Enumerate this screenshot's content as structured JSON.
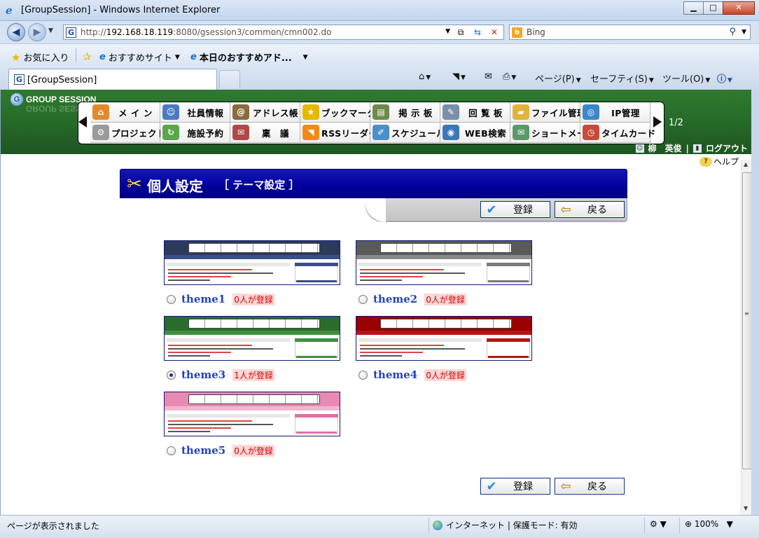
{
  "window": {
    "title": "[GroupSession] - Windows Internet Explorer",
    "minimize_glyph": "▁",
    "maximize_glyph": "□",
    "close_glyph": "✕"
  },
  "address": {
    "url_prefix": "http://",
    "url_host": "192.168.18.119",
    "url_rest": ":8080/gsession3/common/cmn002.do",
    "search_provider": "Bing"
  },
  "favorites_bar": {
    "favorites_label": "お気に入り",
    "suggested_sites": "おすすめサイト",
    "web_slice": "本日のおすすめアド..."
  },
  "tab": {
    "label": "[GroupSession]"
  },
  "commands": {
    "page": "ページ(P)",
    "safety": "セーフティ(S)",
    "tools": "ツール(O)"
  },
  "gs": {
    "logo": "GROUP SESSION",
    "page_indicator": "1/2",
    "user_name": "柳　英俊",
    "logout": "ログアウト",
    "help": "ヘルプ",
    "menu": [
      {
        "label": "メ イ ン",
        "icon": "home-icon",
        "color": "#e08a2e",
        "glyph": "⌂"
      },
      {
        "label": "社員情報",
        "icon": "person-icon",
        "color": "#4a7bc0",
        "glyph": "☺"
      },
      {
        "label": "アドレス帳",
        "icon": "address-book-icon",
        "color": "#8a6b3a",
        "glyph": "@"
      },
      {
        "label": "ブックマーク",
        "icon": "star-icon",
        "color": "#e6b800",
        "glyph": "★"
      },
      {
        "label": "掲 示 板",
        "icon": "board-icon",
        "color": "#6e8a4a",
        "glyph": "▤"
      },
      {
        "label": "回 覧 板",
        "icon": "circular-icon",
        "color": "#7a8fa8",
        "glyph": "✎"
      },
      {
        "label": "ファイル管理",
        "icon": "folder-icon",
        "color": "#e0b43c",
        "glyph": "▰"
      },
      {
        "label": "IP管理",
        "icon": "ip-icon",
        "color": "#3c87c8",
        "glyph": "◎"
      },
      {
        "label": "プロジェクト",
        "icon": "gear-icon",
        "color": "#9a9a9a",
        "glyph": "⚙"
      },
      {
        "label": "施設予約",
        "icon": "facility-icon",
        "color": "#5aa64a",
        "glyph": "↻"
      },
      {
        "label": "稟　議",
        "icon": "approval-icon",
        "color": "#b04848",
        "glyph": "✉"
      },
      {
        "label": "RSSリーダー",
        "icon": "rss-icon",
        "color": "#f08c14",
        "glyph": "◥"
      },
      {
        "label": "スケジュール",
        "icon": "schedule-icon",
        "color": "#4a90c8",
        "glyph": "✐"
      },
      {
        "label": "WEB検索",
        "icon": "web-search-icon",
        "color": "#3a78b8",
        "glyph": "◉"
      },
      {
        "label": "ショートメール",
        "icon": "short-mail-icon",
        "color": "#5a9a6a",
        "glyph": "✉"
      },
      {
        "label": "タイムカード",
        "icon": "clock-icon",
        "color": "#c84a3a",
        "glyph": "◷"
      }
    ]
  },
  "page": {
    "title": "個人設定",
    "subtitle": "［ テーマ設定 ］",
    "register_button": "登録",
    "back_button": "戻る"
  },
  "themes": [
    {
      "name": "theme1",
      "count_text": "0人が登録",
      "selected": false,
      "head_color": "#2e3a5c",
      "bar_color": "#3a4f86",
      "accent": "#3a4f86"
    },
    {
      "name": "theme2",
      "count_text": "0人が登録",
      "selected": false,
      "head_color": "#5a5a5a",
      "bar_color": "#8a8a8a",
      "accent": "#7a7a7a"
    },
    {
      "name": "theme3",
      "count_text": "1人が登録",
      "selected": true,
      "head_color": "#2a6c2c",
      "bar_color": "#3f8f3f",
      "accent": "#3f8f3f"
    },
    {
      "name": "theme4",
      "count_text": "0人が登録",
      "selected": false,
      "head_color": "#9a0000",
      "bar_color": "#b81414",
      "accent": "#b81414"
    },
    {
      "name": "theme5",
      "count_text": "0人が登録",
      "selected": false,
      "head_color": "#e88ab4",
      "bar_color": "#f3b6cf",
      "accent": "#e070a0"
    }
  ],
  "status": {
    "text": "ページが表示されました",
    "zone": "インターネット | 保護モード: 有効",
    "zoom": "100%"
  }
}
